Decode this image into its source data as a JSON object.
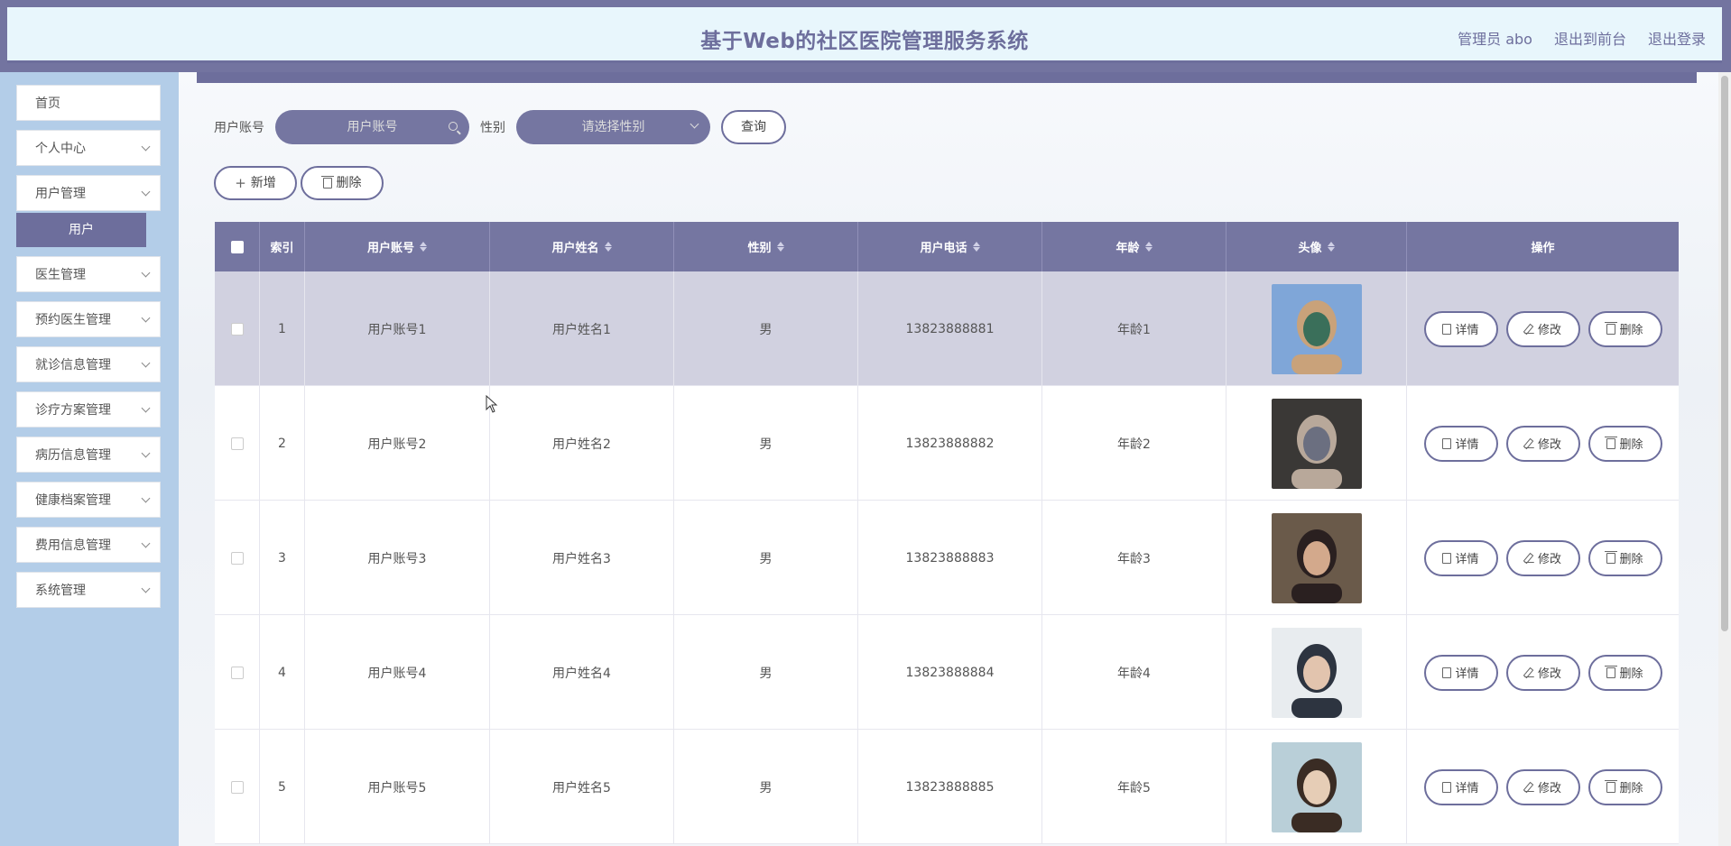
{
  "header": {
    "title": "基于Web的社区医院管理服务系统",
    "nav": [
      "管理员 abo",
      "退出到前台",
      "退出登录"
    ]
  },
  "sidebar": {
    "items": [
      {
        "label": "首页",
        "has_children": false
      },
      {
        "label": "个人中心",
        "has_children": true
      },
      {
        "label": "用户管理",
        "has_children": true
      },
      {
        "label": "医生管理",
        "has_children": true
      },
      {
        "label": "预约医生管理",
        "has_children": true
      },
      {
        "label": "就诊信息管理",
        "has_children": true
      },
      {
        "label": "诊疗方案管理",
        "has_children": true
      },
      {
        "label": "病历信息管理",
        "has_children": true
      },
      {
        "label": "健康档案管理",
        "has_children": true
      },
      {
        "label": "费用信息管理",
        "has_children": true
      },
      {
        "label": "系统管理",
        "has_children": true
      }
    ],
    "active_sub": "用户"
  },
  "search": {
    "account_label": "用户账号",
    "account_placeholder": "用户账号",
    "gender_label": "性别",
    "gender_placeholder": "请选择性别",
    "query_button": "查询"
  },
  "actions": {
    "add": "新增",
    "delete": "删除"
  },
  "table": {
    "columns": [
      "索引",
      "用户账号",
      "用户姓名",
      "性别",
      "用户电话",
      "年龄",
      "头像",
      "操作"
    ],
    "op_labels": {
      "detail": "详情",
      "edit": "修改",
      "delete": "删除"
    },
    "rows": [
      {
        "index": "1",
        "account": "用户账号1",
        "name": "用户姓名1",
        "gender": "男",
        "phone": "13823888881",
        "age": "年龄1"
      },
      {
        "index": "2",
        "account": "用户账号2",
        "name": "用户姓名2",
        "gender": "男",
        "phone": "13823888882",
        "age": "年龄2"
      },
      {
        "index": "3",
        "account": "用户账号3",
        "name": "用户姓名3",
        "gender": "男",
        "phone": "13823888883",
        "age": "年龄3"
      },
      {
        "index": "4",
        "account": "用户账号4",
        "name": "用户姓名4",
        "gender": "男",
        "phone": "13823888884",
        "age": "年龄4"
      },
      {
        "index": "5",
        "account": "用户账号5",
        "name": "用户姓名5",
        "gender": "男",
        "phone": "13823888885",
        "age": "年龄5"
      }
    ]
  },
  "colors": {
    "accent": "#6d6e9c",
    "sidebar_bg": "#b3cde8",
    "header_bg": "#e8f6fc",
    "highlight_row": "#d1d1e0"
  }
}
